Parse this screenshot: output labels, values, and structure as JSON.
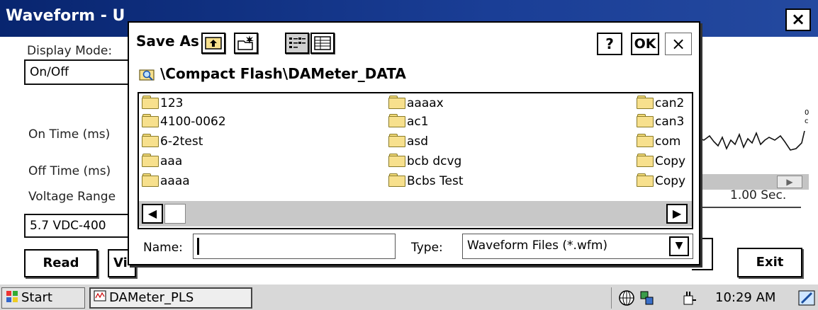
{
  "main_window": {
    "title": "Waveform - U",
    "close_label": "×",
    "display_mode_label": "Display Mode:",
    "display_mode_value": "On/Off",
    "on_time_label": "On Time (ms)",
    "off_time_label": "Off Time (ms)",
    "voltage_range_label": "Voltage Range",
    "voltage_range_value": "5.7 VDC-400",
    "timebase_value": "1.00 Sec.",
    "buttons": {
      "read": "Read",
      "view": "Vi",
      "exit": "Exit"
    }
  },
  "dialog": {
    "title": "Save As",
    "help_label": "?",
    "ok_label": "OK",
    "close_label": "×",
    "path": "\\Compact Flash\\DAMeter_DATA",
    "files": [
      "123",
      "4100-0062",
      "6-2test",
      "aaa",
      "aaaa",
      "aaaax",
      "ac1",
      "asd",
      "bcb dcvg",
      "Bcbs  Test",
      "can2",
      "can3",
      "com",
      "Copy",
      "Copy"
    ],
    "name_label": "Name:",
    "name_value": "",
    "type_label": "Type:",
    "type_value": "Waveform Files (*.wfm)",
    "scroll_left": "◀",
    "scroll_right": "▶",
    "dropdown_arrow": "▼"
  },
  "taskbar": {
    "start_label": "Start",
    "app_label": "DAMeter_PLS",
    "clock": "10:29 AM"
  },
  "icons": {
    "toolbar": [
      "up-folder-icon",
      "new-folder-icon",
      "list-view-icon",
      "details-view-icon"
    ],
    "tray": [
      "network-icon",
      "connection-icon",
      "power-icon",
      "desktop-icon"
    ]
  },
  "colors": {
    "titlebar": "#0a2a7a",
    "folder": "#f7e08d"
  }
}
